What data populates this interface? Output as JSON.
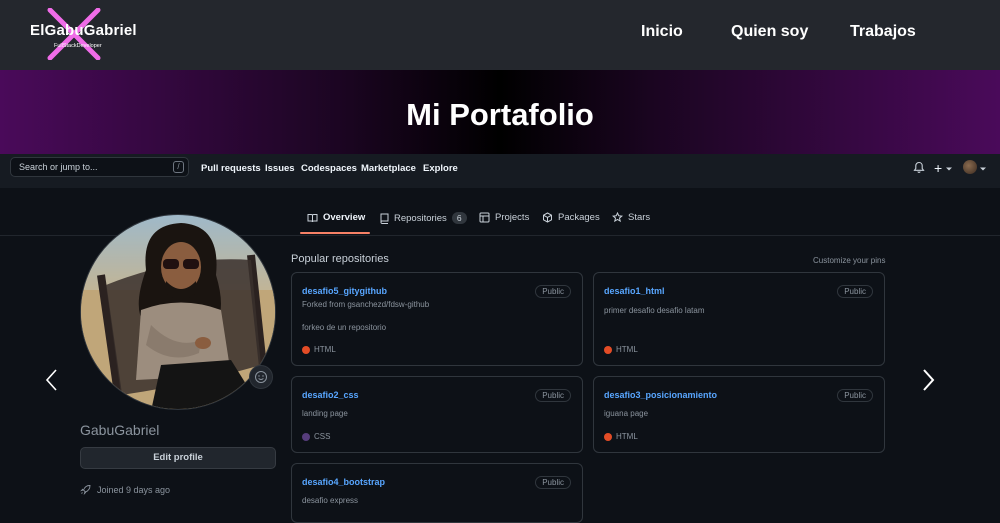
{
  "site": {
    "logo_name": "ElGabuGabriel",
    "logo_sub": "FullStackDeveloper",
    "nav": [
      "Inicio",
      "Quien soy",
      "Trabajos"
    ],
    "banner_title": "Mi Portafolio"
  },
  "github": {
    "search_text": "Search or jump to...",
    "slash": "/",
    "links": [
      "Pull requests",
      "Issues",
      "Codespaces",
      "Marketplace",
      "Explore"
    ],
    "plus": "+",
    "tabs": [
      {
        "label": "Overview"
      },
      {
        "label": "Repositories",
        "count": "6"
      },
      {
        "label": "Projects"
      },
      {
        "label": "Packages"
      },
      {
        "label": "Stars"
      }
    ],
    "profile": {
      "name": "GabuGabriel",
      "edit_label": "Edit profile",
      "joined": "Joined 9 days ago"
    },
    "popular_title": "Popular repositories",
    "customize": "Customize your pins",
    "repos": [
      {
        "name": "desafio5_gitygithub",
        "badge": "Public",
        "forked": "Forked from gsanchezd/fdsw-github",
        "desc": "forkeo de un repositorio",
        "lang": "HTML",
        "lang_color": "#e34c26"
      },
      {
        "name": "desafio1_html",
        "badge": "Public",
        "desc": "primer desafio desafio latam",
        "lang": "HTML",
        "lang_color": "#e34c26"
      },
      {
        "name": "desafio2_css",
        "badge": "Public",
        "desc": "landing page",
        "lang": "CSS",
        "lang_color": "#563d7c"
      },
      {
        "name": "desafio3_posicionamiento",
        "badge": "Public",
        "desc": "iguana page",
        "lang": "HTML",
        "lang_color": "#e34c26"
      },
      {
        "name": "desafio4_bootstrap",
        "badge": "Public",
        "desc": "desafio express"
      }
    ]
  },
  "colors": {
    "accent_link": "#58a6ff",
    "tab_underline": "#f78166",
    "logo_x": "#f06ce8",
    "banner_purple": "#4a0a5a"
  }
}
